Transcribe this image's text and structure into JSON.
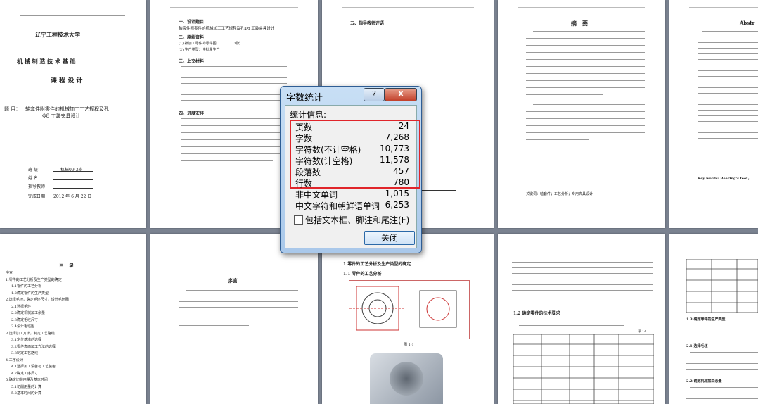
{
  "pages": {
    "cover": {
      "university": "辽宁工程技术大学",
      "course": "机 械 制 造 技 术 基 础",
      "design": "课 程 设 计",
      "topic_label": "题 目：",
      "topic": "轴套件附零件的机械加工工艺规程及孔",
      "topic2": "Φ8 工装夹具设计",
      "class_label": "班 级：",
      "class_val": "机械09-3班",
      "name_label": "姓 名：",
      "teacher_label": "指导教师：",
      "date_label": "完成日期：",
      "date_val": "2012 年 6 月 22 日"
    },
    "p2": {
      "h1": "一、设计题目",
      "h1_text": "轴套件附零件的机械加工工艺规程及孔Φ8 工装夹具设计",
      "h2": "二、原始资料",
      "items": [
        "(1) 被加工零件的零件图　　　　　1张",
        "(2) 生产类型：中批量生产"
      ],
      "h3": "三、上交材料",
      "h4": "四、进度安排"
    },
    "p3": {
      "h": "五、指导教师评语"
    },
    "p4": {
      "title": "摘　要",
      "keywords": "关键词：轴套件；工艺分析；专用夹具设计"
    },
    "p5": {
      "title": "Abstr",
      "keywords": "Key words: Bearing's feet，"
    },
    "toc": {
      "title": "目　录",
      "entries": [
        "序言",
        "1.零件的工艺分析及生产类型的确定",
        "1.1零件的工艺分析",
        "1.2确定零件的生产类型",
        "2.选择毛坯，确定毛坯尺寸，设计毛坯图",
        "2.1选择毛坯",
        "2.2确定机械加工余量",
        "2.3确定毛坯尺寸",
        "2.4设计毛坯图",
        "3.选择加工方法，制定工艺路线",
        "3.1定位基准的选择",
        "3.2零件表面加工方法的选择",
        "3.3制定工艺路线",
        "4.工序设计",
        "4.1选择加工设备与工艺装备",
        "4.2确定工序尺寸",
        "5.确定切削用量及基本时间",
        "5.1切削用量的计算",
        "5.2基本时间的计算"
      ]
    },
    "preface": {
      "title": "序言"
    },
    "p8": {
      "h1": "1 零件的工艺分析及生产类型的确定",
      "h2": "1.1 零件的工艺分析",
      "fig": "图 1-1"
    },
    "p9": {
      "h": "1.2 确定零件的技术要求",
      "table_caption": "表 1-1"
    },
    "p10": {
      "h1": "1.3 确定零件的生产类型",
      "h2": "2.1 选择毛坯",
      "h3": "2.2 确定机械加工余量"
    }
  },
  "dialog": {
    "title": "字数统计",
    "help_label": "?",
    "close_x": "X",
    "stats_header": "统计信息:",
    "stats": [
      {
        "label": "页数",
        "value": "24"
      },
      {
        "label": "字数",
        "value": "7,268"
      },
      {
        "label": "字符数(不计空格)",
        "value": "10,773"
      },
      {
        "label": "字符数(计空格)",
        "value": "11,578"
      },
      {
        "label": "段落数",
        "value": "457"
      },
      {
        "label": "行数",
        "value": "780"
      },
      {
        "label": "非中文单词",
        "value": "1,015"
      },
      {
        "label": "中文字符和朝鲜语单词",
        "value": "6,253"
      }
    ],
    "checkbox_label": "包括文本框、脚注和尾注(F)",
    "close_button": "关闭"
  },
  "colors": {
    "highlight": "#e0252a",
    "dialog_border": "#2e5d94"
  }
}
